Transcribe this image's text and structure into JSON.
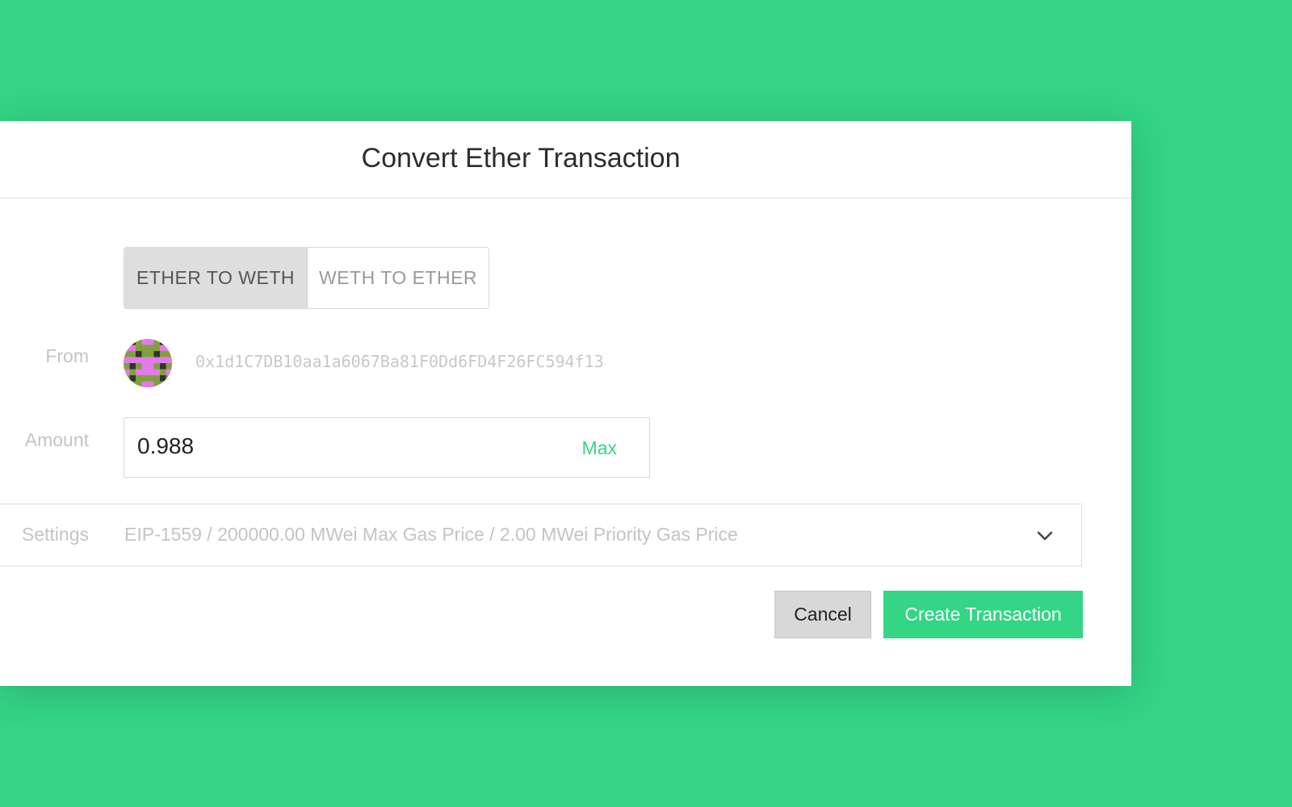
{
  "dialog": {
    "title": "Convert Ether Transaction",
    "direction_toggle": {
      "options": [
        "ETHER TO WETH",
        "WETH TO ETHER"
      ],
      "selected": "ETHER TO WETH"
    },
    "from": {
      "label": "From",
      "avatar_icon": "identicon-avatar",
      "address": "0x1d1C7DB10aa1a6067Ba81F0Dd6FD4F26FC594f13"
    },
    "amount": {
      "label": "Amount",
      "value": "0.988",
      "max_label": "Max"
    },
    "settings": {
      "label": "Settings",
      "summary": "EIP-1559 / 200000.00 MWei Max Gas Price / 2.00 MWei Priority Gas Price",
      "expand_icon": "chevron-down-icon"
    },
    "buttons": {
      "cancel": "Cancel",
      "create": "Create Transaction"
    }
  },
  "colors": {
    "background": "#34d585",
    "accent": "#34d585",
    "panel": "#ffffff"
  }
}
